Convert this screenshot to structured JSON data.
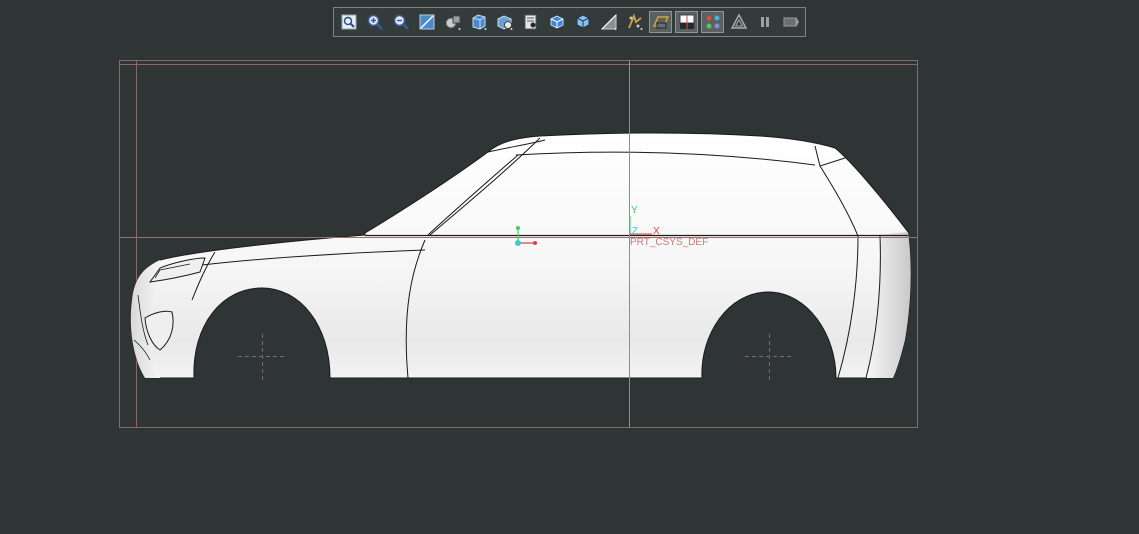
{
  "toolbar": {
    "buttons": [
      {
        "id": "refit",
        "icon": "refit-icon"
      },
      {
        "id": "zoom-in",
        "icon": "zoom-in-icon"
      },
      {
        "id": "zoom-out",
        "icon": "zoom-out-icon"
      },
      {
        "id": "repaint",
        "icon": "repaint-icon"
      },
      {
        "id": "display-style",
        "icon": "display-style-icon"
      },
      {
        "id": "saved-orientations",
        "icon": "saved-orientations-icon"
      },
      {
        "id": "view-manager",
        "icon": "view-manager-icon"
      },
      {
        "id": "perspective",
        "icon": "perspective-icon"
      },
      {
        "id": "section",
        "icon": "section-icon"
      },
      {
        "id": "spin-center",
        "icon": "spin-center-icon"
      },
      {
        "id": "datum-display",
        "icon": "datum-display-icon"
      },
      {
        "id": "annotation-display",
        "icon": "annotation-display-icon"
      },
      {
        "id": "plane-display",
        "icon": "plane-display-icon"
      },
      {
        "id": "axis-display",
        "icon": "axis-display-icon"
      },
      {
        "id": "point-display",
        "icon": "point-display-icon"
      },
      {
        "id": "csys-display",
        "icon": "csys-display-icon"
      },
      {
        "id": "pause",
        "icon": "pause-icon"
      },
      {
        "id": "next",
        "icon": "next-icon"
      }
    ]
  },
  "model": {
    "csys_name": "PRT_CSYS_DEF",
    "axis_x": "X",
    "axis_y": "Y",
    "axis_z": "Z"
  },
  "colors": {
    "background": "#2f3535",
    "body": "#f2f2f2",
    "datum_line": "#b07070",
    "csys_x": "#e04040",
    "csys_y": "#40d060",
    "csys_z": "#40c8d8"
  }
}
